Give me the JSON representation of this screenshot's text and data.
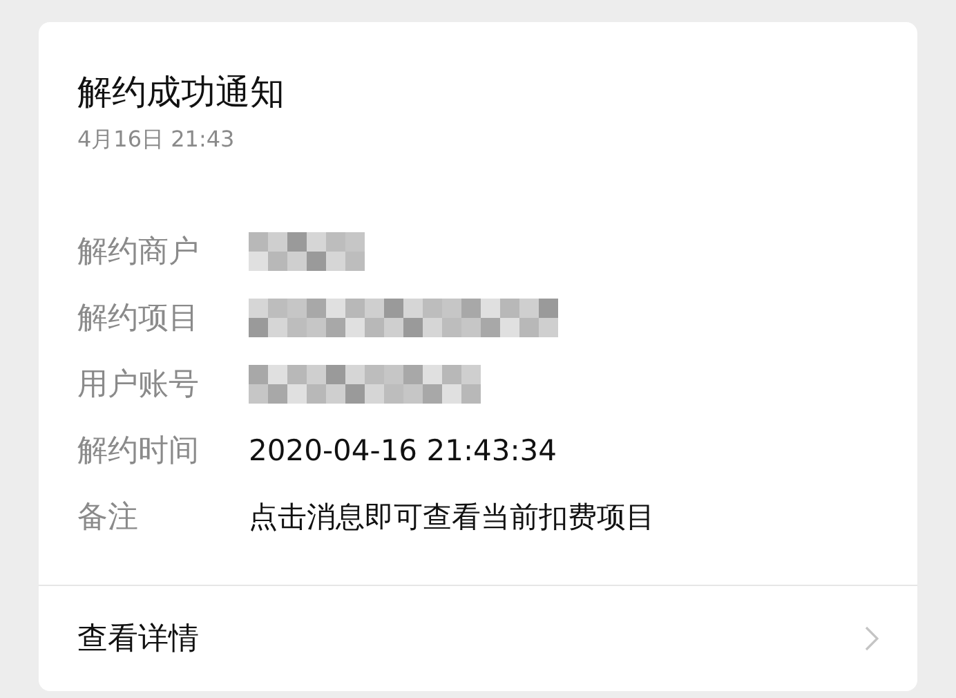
{
  "card": {
    "title": "解约成功通知",
    "time": "4月16日  21:43",
    "fields": [
      {
        "label": "解约商户",
        "value": {
          "kind": "redacted"
        }
      },
      {
        "label": "解约项目",
        "value": {
          "kind": "redacted"
        }
      },
      {
        "label": "用户账号",
        "value": {
          "kind": "redacted"
        }
      },
      {
        "label": "解约时间",
        "value": {
          "kind": "text",
          "text": "2020-04-16 21:43:34"
        }
      },
      {
        "label": "备注",
        "value": {
          "kind": "text",
          "text": "点击消息即可查看当前扣费项目"
        }
      }
    ],
    "link": {
      "label": "查看详情"
    }
  }
}
